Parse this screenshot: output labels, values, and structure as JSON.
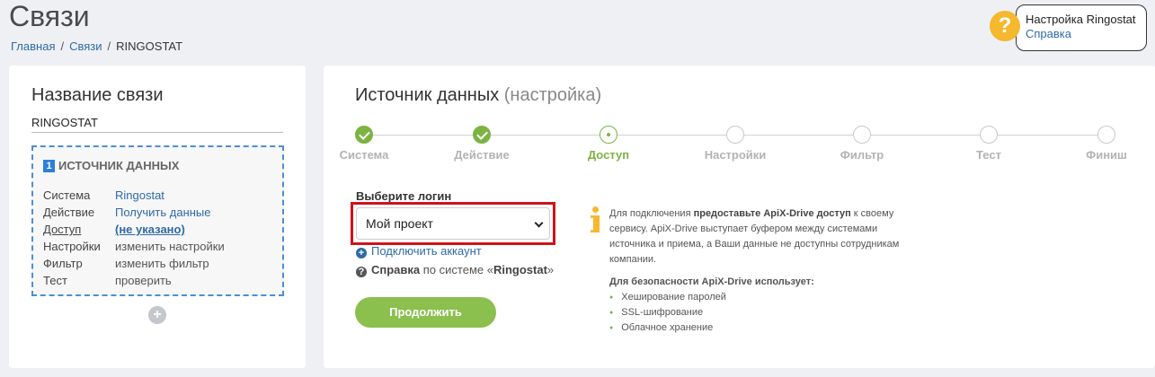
{
  "page": {
    "title": "Связи",
    "breadcrumb": [
      "Главная",
      "Связи",
      "RINGOSTAT"
    ]
  },
  "help": {
    "icon": "question-circle-icon",
    "title": "Настройка Ringostat",
    "link": "Справка"
  },
  "left_panel": {
    "title": "Название связи",
    "connection_name": "RINGOSTAT",
    "source": {
      "number": "1",
      "heading": "ИСТОЧНИК ДАННЫХ",
      "rows": [
        {
          "key": "Система",
          "value": "Ringostat"
        },
        {
          "key": "Действие",
          "value": "Получить данные"
        },
        {
          "key": "Доступ",
          "value": "(не указано)"
        },
        {
          "key": "Настройки",
          "value": "изменить настройки"
        },
        {
          "key": "Фильтр",
          "value": "изменить фильтр"
        },
        {
          "key": "Тест",
          "value": "проверить"
        }
      ]
    },
    "add_button": "+"
  },
  "right_panel": {
    "title": "Источник данных",
    "title_sub": "(настройка)",
    "steps": [
      {
        "label": "Система",
        "state": "done"
      },
      {
        "label": "Действие",
        "state": "done"
      },
      {
        "label": "Доступ",
        "state": "current"
      },
      {
        "label": "Настройки",
        "state": "pending"
      },
      {
        "label": "Фильтр",
        "state": "pending"
      },
      {
        "label": "Тест",
        "state": "pending"
      },
      {
        "label": "Финиш",
        "state": "pending"
      }
    ],
    "login_label": "Выберите логин",
    "login_selected": "Мой проект",
    "connect_account": "Подключить аккаунт",
    "help_bold": "Справка",
    "help_text": "по системе «",
    "help_system": "Ringostat",
    "help_end": "»",
    "continue": "Продолжить",
    "info": {
      "p1_start": "Для подключения ",
      "p1_bold": "предоставьте ApiX-Drive доступ",
      "p1_end": " к своему сервису. ApiX-Drive выступает буфером между системами источника и приема, а Ваши данные не доступны сотрудникам компании.",
      "security_title": "Для безопасности ApiX-Drive использует:",
      "security_items": [
        "Хеширование паролей",
        "SSL-шифрование",
        "Облачное хранение"
      ]
    }
  },
  "colors": {
    "accent_green": "#7cb342",
    "button_green": "#8bbf4e",
    "link_blue": "#2f6aa8",
    "highlight_red": "#d0121b",
    "help_yellow": "#f5b82e"
  }
}
